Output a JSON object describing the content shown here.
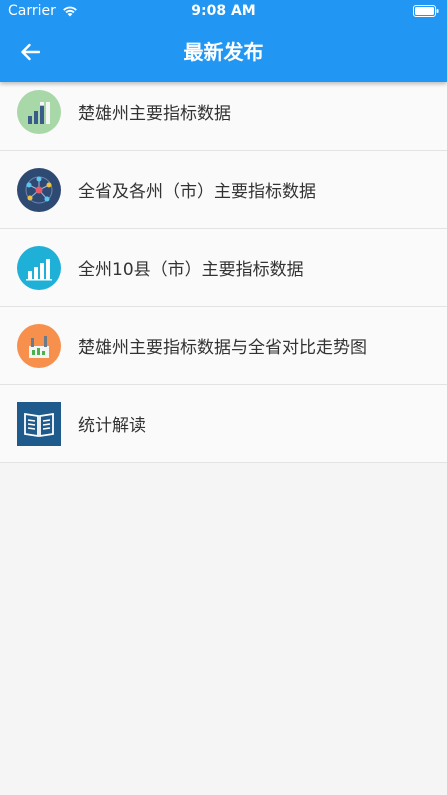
{
  "status_bar": {
    "carrier": "Carrier",
    "time": "9:08 AM"
  },
  "appbar": {
    "title": "最新发布",
    "color": "#2196f3"
  },
  "items": [
    {
      "label": "楚雄州主要指标数据",
      "icon": "green-bar-chart-icon"
    },
    {
      "label": "全省及各州（市）主要指标数据",
      "icon": "network-nodes-icon"
    },
    {
      "label": "全州10县（市）主要指标数据",
      "icon": "blue-bar-chart-icon"
    },
    {
      "label": "楚雄州主要指标数据与全省对比走势图",
      "icon": "orange-factory-chart-icon"
    },
    {
      "label": "统计解读",
      "icon": "open-book-icon"
    }
  ]
}
